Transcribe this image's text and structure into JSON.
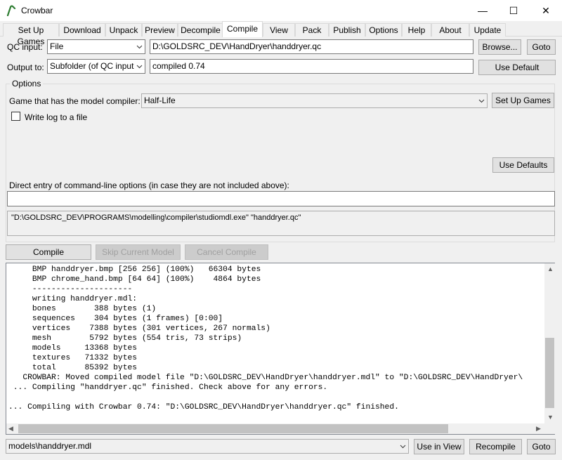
{
  "window": {
    "title": "Crowbar",
    "minimize_glyph": "—",
    "maximize_glyph": "☐",
    "close_glyph": "✕"
  },
  "tabs": [
    {
      "label": "Set Up Games"
    },
    {
      "label": "Download"
    },
    {
      "label": "Unpack"
    },
    {
      "label": "Preview"
    },
    {
      "label": "Decompile"
    },
    {
      "label": "Compile"
    },
    {
      "label": "View"
    },
    {
      "label": "Pack"
    },
    {
      "label": "Publish"
    },
    {
      "label": "Options"
    },
    {
      "label": "Help"
    },
    {
      "label": "About"
    },
    {
      "label": "Update"
    }
  ],
  "active_tab": "Compile",
  "compile": {
    "qc_input_label": "QC input:",
    "qc_input_mode": "File",
    "qc_input_path": "D:\\GOLDSRC_DEV\\HandDryer\\handdryer.qc",
    "browse_label": "Browse...",
    "goto_label": "Goto",
    "output_label": "Output to:",
    "output_mode": "Subfolder (of QC input",
    "output_value": "compiled 0.74",
    "use_default_label": "Use Default",
    "options_title": "Options",
    "game_label": "Game that has the model compiler:",
    "game_value": "Half-Life",
    "setup_games_label": "Set Up Games",
    "write_log_label": "Write log to a file",
    "write_log_checked": false,
    "use_defaults_label": "Use Defaults",
    "direct_entry_label": "Direct entry of command-line options (in case they are not included above):",
    "direct_entry_value": "",
    "command_line": "\"D:\\GOLDSRC_DEV\\PROGRAMS\\modelling\\compiler\\studiomdl.exe\" \"handdryer.qc\"",
    "compile_button": "Compile",
    "skip_button": "Skip Current Model",
    "cancel_button": "Cancel Compile"
  },
  "log_lines": [
    "     BMP handdryer.bmp [256 256] (100%)   66304 bytes",
    "     BMP chrome_hand.bmp [64 64] (100%)    4864 bytes",
    "     ---------------------",
    "     writing handdryer.mdl:",
    "     bones        388 bytes (1)",
    "     sequences    304 bytes (1 frames) [0:00]",
    "     vertices    7388 bytes (301 vertices, 267 normals)",
    "     mesh        5792 bytes (554 tris, 73 strips)",
    "     models     13368 bytes",
    "     textures   71332 bytes",
    "     total      85392 bytes",
    "   CROWBAR: Moved compiled model file \"D:\\GOLDSRC_DEV\\HandDryer\\handdryer.mdl\" to \"D:\\GOLDSRC_DEV\\HandDryer\\",
    " ... Compiling \"handdryer.qc\" finished. Check above for any errors.",
    "",
    "... Compiling with Crowbar 0.74: \"D:\\GOLDSRC_DEV\\HandDryer\\handdryer.qc\" finished.",
    ""
  ],
  "bottom": {
    "model_value": "models\\handdryer.mdl",
    "use_in_view_label": "Use in View",
    "recompile_label": "Recompile",
    "goto_label": "Goto"
  },
  "colors": {
    "accent_logo": "#2e7d32",
    "button_face": "#e1e1e1",
    "window_bg": "#f0f0f0"
  },
  "icons": {
    "logo": "crowbar-logo-icon",
    "dropdown": "chevron-down-icon"
  }
}
